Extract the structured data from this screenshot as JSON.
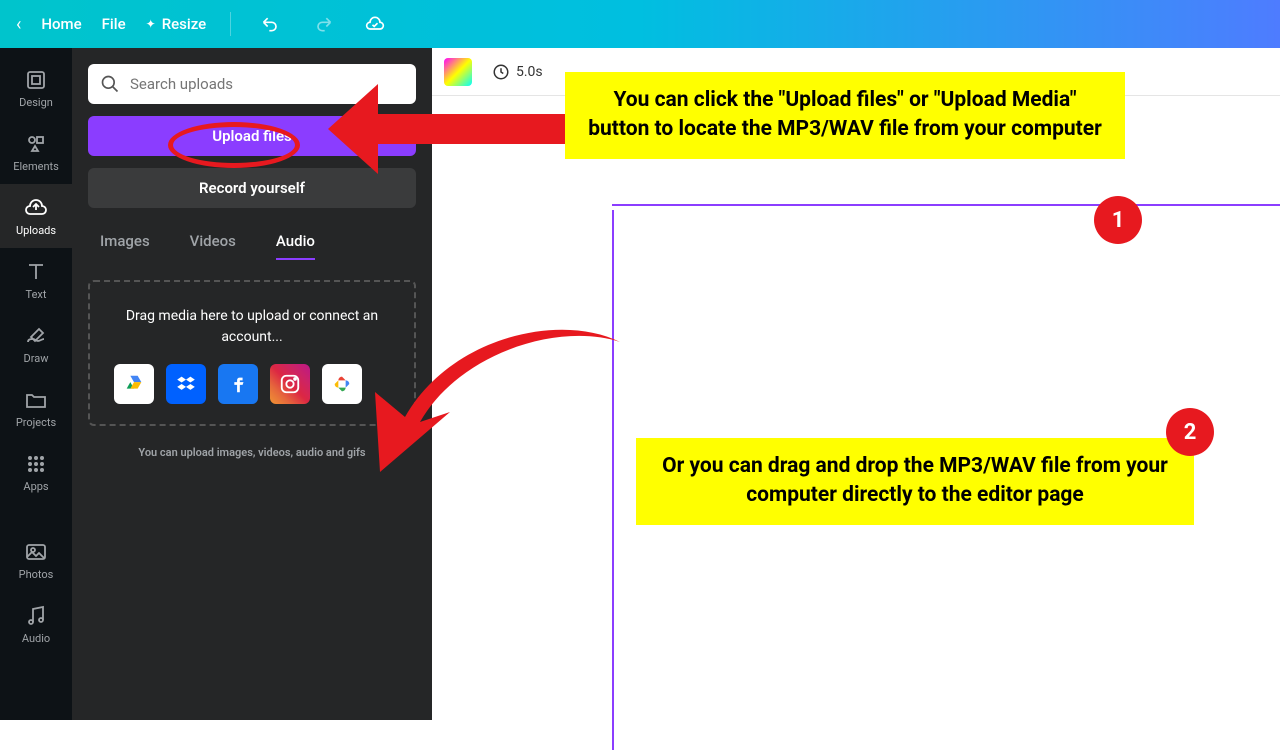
{
  "topbar": {
    "home": "Home",
    "file": "File",
    "resize": "Resize"
  },
  "nav": {
    "design": "Design",
    "elements": "Elements",
    "uploads": "Uploads",
    "text": "Text",
    "draw": "Draw",
    "projects": "Projects",
    "apps": "Apps",
    "photos": "Photos",
    "audio": "Audio"
  },
  "panel": {
    "search_placeholder": "Search uploads",
    "upload_btn": "Upload files",
    "record_btn": "Record yourself",
    "tab_images": "Images",
    "tab_videos": "Videos",
    "tab_audio": "Audio",
    "drop_text": "Drag media here to upload or connect an account...",
    "note": "You can upload images, videos, audio and gifs"
  },
  "canvas": {
    "duration": "5.0s"
  },
  "callouts": {
    "c1": "You can click the \"Upload files\" or \"Upload Media\" button to locate the MP3/WAV file from your computer",
    "c2": "Or you can drag and drop the MP3/WAV file from your computer directly to the editor page",
    "badge1": "1",
    "badge2": "2"
  }
}
